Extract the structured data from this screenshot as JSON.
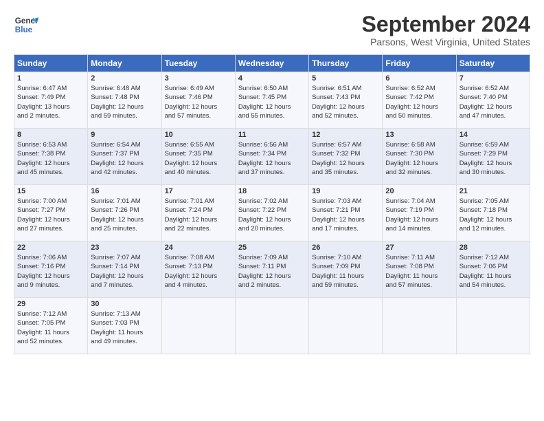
{
  "header": {
    "logo_line1": "General",
    "logo_line2": "Blue",
    "month": "September 2024",
    "location": "Parsons, West Virginia, United States"
  },
  "weekdays": [
    "Sunday",
    "Monday",
    "Tuesday",
    "Wednesday",
    "Thursday",
    "Friday",
    "Saturday"
  ],
  "weeks": [
    [
      {
        "day": "1",
        "lines": [
          "Sunrise: 6:47 AM",
          "Sunset: 7:49 PM",
          "Daylight: 13 hours",
          "and 2 minutes."
        ]
      },
      {
        "day": "2",
        "lines": [
          "Sunrise: 6:48 AM",
          "Sunset: 7:48 PM",
          "Daylight: 12 hours",
          "and 59 minutes."
        ]
      },
      {
        "day": "3",
        "lines": [
          "Sunrise: 6:49 AM",
          "Sunset: 7:46 PM",
          "Daylight: 12 hours",
          "and 57 minutes."
        ]
      },
      {
        "day": "4",
        "lines": [
          "Sunrise: 6:50 AM",
          "Sunset: 7:45 PM",
          "Daylight: 12 hours",
          "and 55 minutes."
        ]
      },
      {
        "day": "5",
        "lines": [
          "Sunrise: 6:51 AM",
          "Sunset: 7:43 PM",
          "Daylight: 12 hours",
          "and 52 minutes."
        ]
      },
      {
        "day": "6",
        "lines": [
          "Sunrise: 6:52 AM",
          "Sunset: 7:42 PM",
          "Daylight: 12 hours",
          "and 50 minutes."
        ]
      },
      {
        "day": "7",
        "lines": [
          "Sunrise: 6:52 AM",
          "Sunset: 7:40 PM",
          "Daylight: 12 hours",
          "and 47 minutes."
        ]
      }
    ],
    [
      {
        "day": "8",
        "lines": [
          "Sunrise: 6:53 AM",
          "Sunset: 7:38 PM",
          "Daylight: 12 hours",
          "and 45 minutes."
        ]
      },
      {
        "day": "9",
        "lines": [
          "Sunrise: 6:54 AM",
          "Sunset: 7:37 PM",
          "Daylight: 12 hours",
          "and 42 minutes."
        ]
      },
      {
        "day": "10",
        "lines": [
          "Sunrise: 6:55 AM",
          "Sunset: 7:35 PM",
          "Daylight: 12 hours",
          "and 40 minutes."
        ]
      },
      {
        "day": "11",
        "lines": [
          "Sunrise: 6:56 AM",
          "Sunset: 7:34 PM",
          "Daylight: 12 hours",
          "and 37 minutes."
        ]
      },
      {
        "day": "12",
        "lines": [
          "Sunrise: 6:57 AM",
          "Sunset: 7:32 PM",
          "Daylight: 12 hours",
          "and 35 minutes."
        ]
      },
      {
        "day": "13",
        "lines": [
          "Sunrise: 6:58 AM",
          "Sunset: 7:30 PM",
          "Daylight: 12 hours",
          "and 32 minutes."
        ]
      },
      {
        "day": "14",
        "lines": [
          "Sunrise: 6:59 AM",
          "Sunset: 7:29 PM",
          "Daylight: 12 hours",
          "and 30 minutes."
        ]
      }
    ],
    [
      {
        "day": "15",
        "lines": [
          "Sunrise: 7:00 AM",
          "Sunset: 7:27 PM",
          "Daylight: 12 hours",
          "and 27 minutes."
        ]
      },
      {
        "day": "16",
        "lines": [
          "Sunrise: 7:01 AM",
          "Sunset: 7:26 PM",
          "Daylight: 12 hours",
          "and 25 minutes."
        ]
      },
      {
        "day": "17",
        "lines": [
          "Sunrise: 7:01 AM",
          "Sunset: 7:24 PM",
          "Daylight: 12 hours",
          "and 22 minutes."
        ]
      },
      {
        "day": "18",
        "lines": [
          "Sunrise: 7:02 AM",
          "Sunset: 7:22 PM",
          "Daylight: 12 hours",
          "and 20 minutes."
        ]
      },
      {
        "day": "19",
        "lines": [
          "Sunrise: 7:03 AM",
          "Sunset: 7:21 PM",
          "Daylight: 12 hours",
          "and 17 minutes."
        ]
      },
      {
        "day": "20",
        "lines": [
          "Sunrise: 7:04 AM",
          "Sunset: 7:19 PM",
          "Daylight: 12 hours",
          "and 14 minutes."
        ]
      },
      {
        "day": "21",
        "lines": [
          "Sunrise: 7:05 AM",
          "Sunset: 7:18 PM",
          "Daylight: 12 hours",
          "and 12 minutes."
        ]
      }
    ],
    [
      {
        "day": "22",
        "lines": [
          "Sunrise: 7:06 AM",
          "Sunset: 7:16 PM",
          "Daylight: 12 hours",
          "and 9 minutes."
        ]
      },
      {
        "day": "23",
        "lines": [
          "Sunrise: 7:07 AM",
          "Sunset: 7:14 PM",
          "Daylight: 12 hours",
          "and 7 minutes."
        ]
      },
      {
        "day": "24",
        "lines": [
          "Sunrise: 7:08 AM",
          "Sunset: 7:13 PM",
          "Daylight: 12 hours",
          "and 4 minutes."
        ]
      },
      {
        "day": "25",
        "lines": [
          "Sunrise: 7:09 AM",
          "Sunset: 7:11 PM",
          "Daylight: 12 hours",
          "and 2 minutes."
        ]
      },
      {
        "day": "26",
        "lines": [
          "Sunrise: 7:10 AM",
          "Sunset: 7:09 PM",
          "Daylight: 11 hours",
          "and 59 minutes."
        ]
      },
      {
        "day": "27",
        "lines": [
          "Sunrise: 7:11 AM",
          "Sunset: 7:08 PM",
          "Daylight: 11 hours",
          "and 57 minutes."
        ]
      },
      {
        "day": "28",
        "lines": [
          "Sunrise: 7:12 AM",
          "Sunset: 7:06 PM",
          "Daylight: 11 hours",
          "and 54 minutes."
        ]
      }
    ],
    [
      {
        "day": "29",
        "lines": [
          "Sunrise: 7:12 AM",
          "Sunset: 7:05 PM",
          "Daylight: 11 hours",
          "and 52 minutes."
        ]
      },
      {
        "day": "30",
        "lines": [
          "Sunrise: 7:13 AM",
          "Sunset: 7:03 PM",
          "Daylight: 11 hours",
          "and 49 minutes."
        ]
      },
      {
        "day": "",
        "lines": []
      },
      {
        "day": "",
        "lines": []
      },
      {
        "day": "",
        "lines": []
      },
      {
        "day": "",
        "lines": []
      },
      {
        "day": "",
        "lines": []
      }
    ]
  ]
}
